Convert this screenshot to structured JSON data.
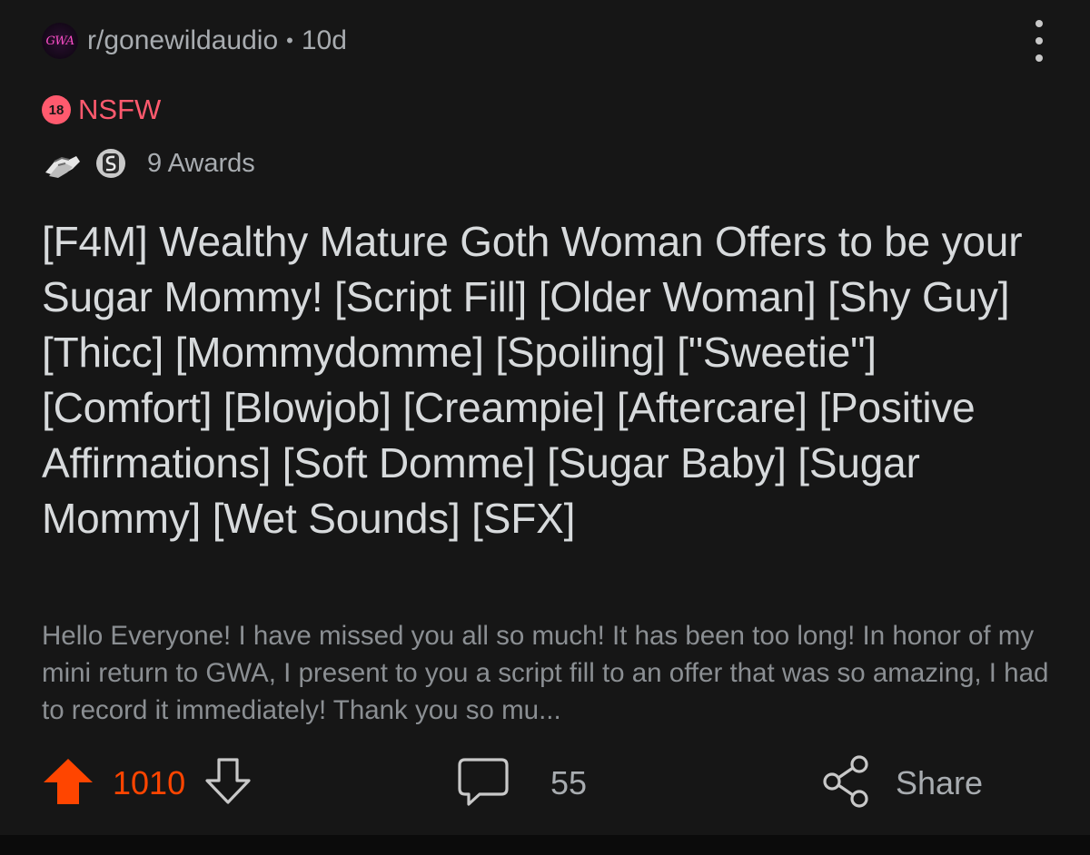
{
  "post": {
    "subreddit": "r/gonewildaudio",
    "subreddit_avatar_text": "GWA",
    "age": "10d",
    "separator": "•",
    "nsfw_badge": "18",
    "nsfw_label": "NSFW",
    "awards_label": "9 Awards",
    "title": "[F4M] Wealthy Mature Goth Woman Offers to be your Sugar Mommy! [Script Fill] [Older Woman] [Shy Guy] [Thicc] [Mommydomme] [Spoiling] [\"Sweetie\"] [Comfort] [Blowjob] [Creampie] [Aftercare] [Positive Affirmations] [Soft Domme] [Sugar Baby] [Sugar Mommy] [Wet Sounds] [SFX]",
    "body_preview": "Hello Everyone! I have missed you all so much! It has been too long!  In honor of my mini return to GWA, I present to you a script fill to an offer that was so amazing, I had to record it immediately! Thank you so mu..."
  },
  "actions": {
    "upvotes": "1010",
    "comments": "55",
    "share_label": "Share"
  },
  "icons": {
    "more": "more-vertical-icon",
    "upvote": "upvote-arrow-icon",
    "downvote": "downvote-arrow-icon",
    "comment": "comment-bubble-icon",
    "share": "share-icon",
    "award1": "helping-hand-award-icon",
    "award2": "silver-award-icon"
  },
  "colors": {
    "upvote_active": "#ff4500",
    "nsfw": "#ff5a6e",
    "muted_text": "#a8acb0",
    "background": "#161616"
  }
}
